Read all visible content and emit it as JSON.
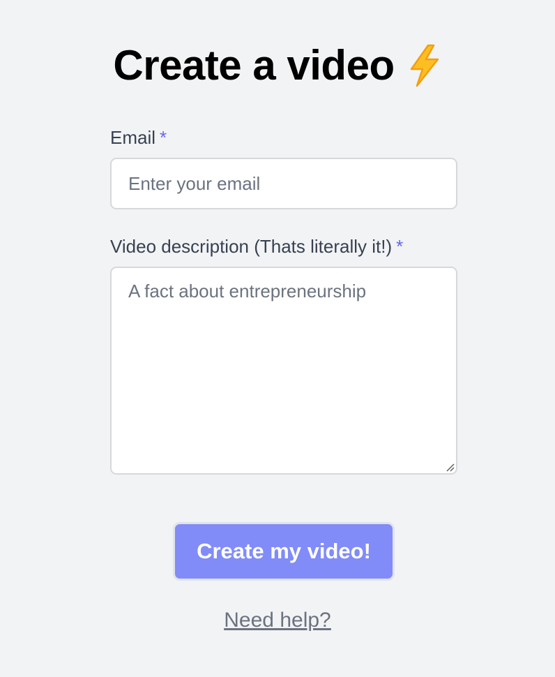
{
  "header": {
    "title": "Create a video",
    "title_icon": "lightning-bolt-icon"
  },
  "form": {
    "email": {
      "label": "Email",
      "required_marker": "*",
      "placeholder": "Enter your email",
      "value": ""
    },
    "description": {
      "label": "Video description (Thats literally it!)",
      "required_marker": "*",
      "placeholder": "A fact about entrepreneurship",
      "value": ""
    },
    "submit_label": "Create my video!"
  },
  "footer": {
    "help_link": "Need help?"
  },
  "colors": {
    "background": "#f2f3f5",
    "accent": "#818cf8",
    "required_marker": "#6366f1",
    "label_text": "#374151",
    "muted_text": "#6b7280",
    "lightning_fill": "#fbbf24",
    "lightning_stroke": "#f59e0b"
  }
}
